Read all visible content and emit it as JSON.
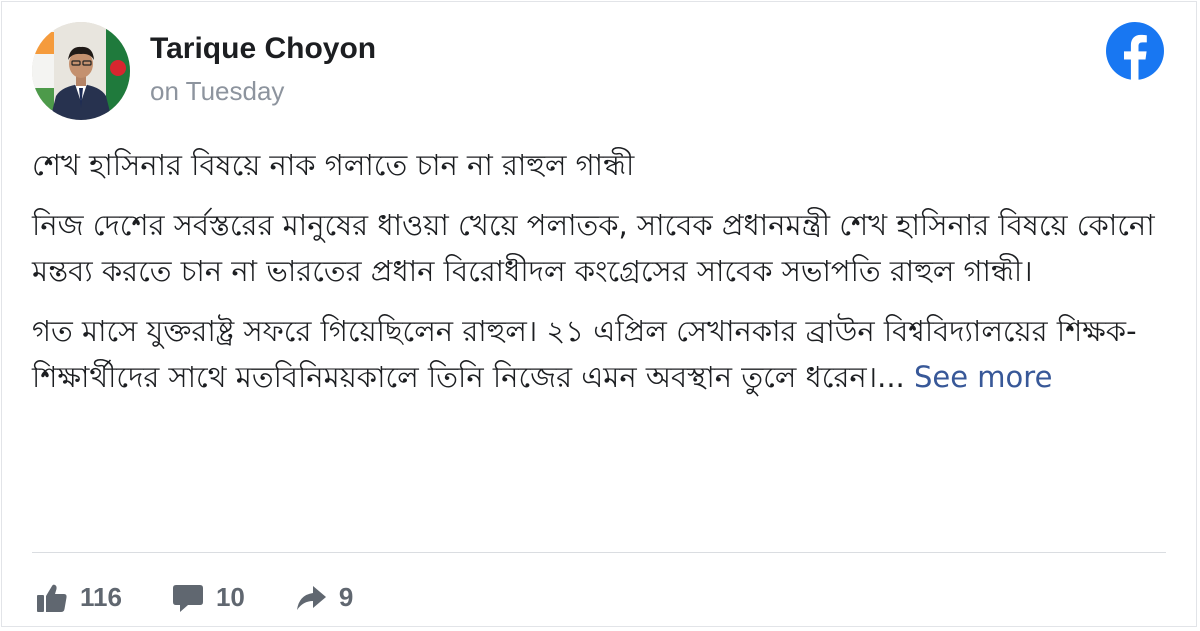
{
  "author": {
    "name": "Tarique Choyon",
    "time": "on Tuesday"
  },
  "icons": {
    "platform": "facebook-logo-icon",
    "like": "thumbs-up-icon",
    "comment": "comment-bubble-icon",
    "share": "share-arrow-icon"
  },
  "colors": {
    "brand": "#1877f2",
    "link": "#385898",
    "stat_gray": "#606770"
  },
  "post": {
    "headline": "শেখ হাসিনার বিষয়ে নাক গলাতে চান না রাহুল গান্ধী",
    "paragraph1": "নিজ দেশের সর্বস্তরের মানুষের ধাওয়া খেয়ে পলাতক, সাবেক প্রধানমন্ত্রী শেখ হাসিনার বিষয়ে কোনো মন্তব্য করতে চান না ভারতের প্রধান বিরোধীদল কংগ্রেসের সাবেক সভাপতি রাহুল গান্ধী।",
    "paragraph2": "গত মাসে যুক্তরাষ্ট্র সফরে গিয়েছিলেন রাহুল। ২১ এপ্রিল সেখানকার ব্রাউন বিশ্ববিদ্যালয়ের শিক্ষক-শিক্ষার্থীদের সাথে মতবিনিময়কালে তিনি নিজের এমন অবস্থান তুলে ধরেন।",
    "ellipsis": "...",
    "see_more": "See more"
  },
  "stats": {
    "likes": "116",
    "comments": "10",
    "shares": "9"
  }
}
